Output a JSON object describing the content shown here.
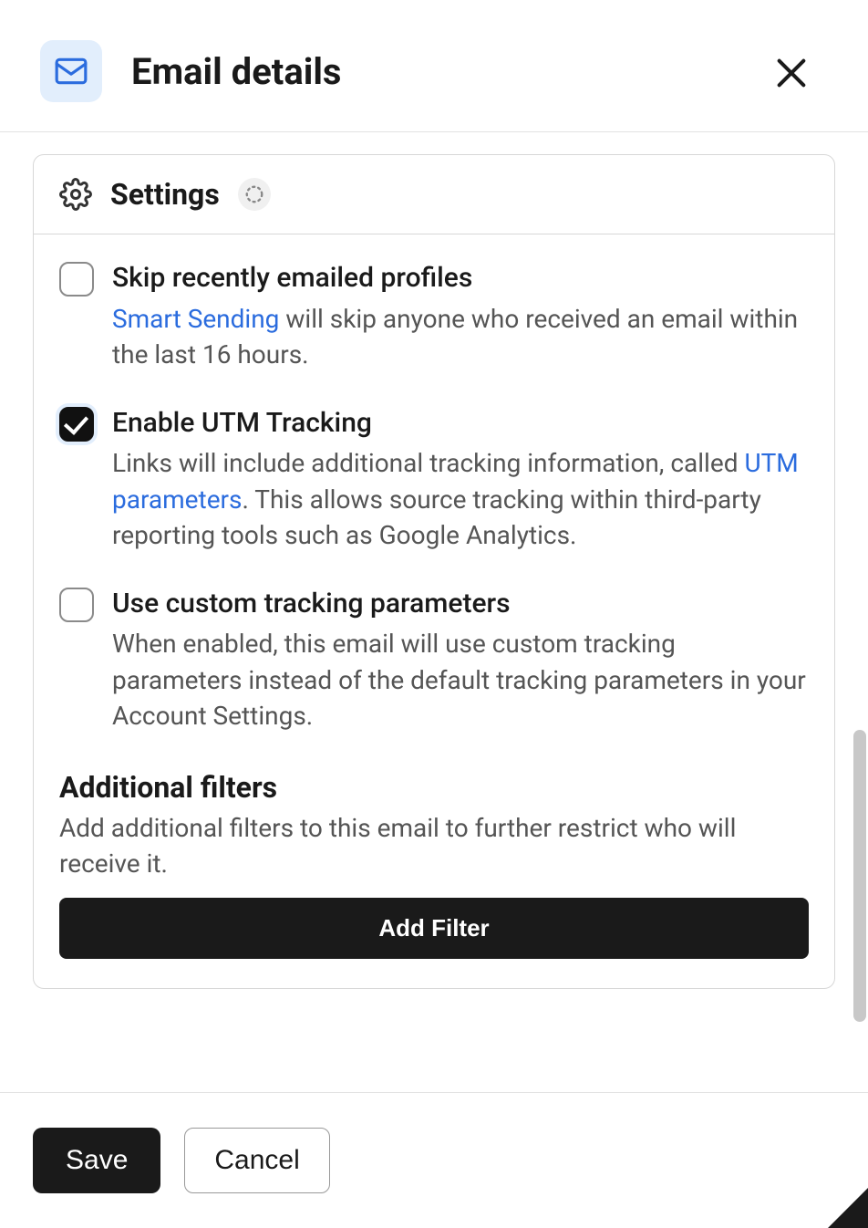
{
  "header": {
    "title": "Email details"
  },
  "panel": {
    "title": "Settings"
  },
  "settings": {
    "skip": {
      "label": "Skip recently emailed profiles",
      "link": "Smart Sending",
      "desc_rest": " will skip anyone who received an email within the last 16 hours.",
      "checked": false
    },
    "utm": {
      "label": "Enable UTM Tracking",
      "desc_before": "Links will include additional tracking information, called ",
      "link": "UTM parameters",
      "desc_after": ". This allows source tracking within third-party reporting tools such as Google Analytics.",
      "checked": true
    },
    "custom": {
      "label": "Use custom tracking parameters",
      "desc": "When enabled, this email will use custom tracking parameters instead of the default tracking parameters in your Account Settings.",
      "checked": false
    }
  },
  "filters": {
    "title": "Additional filters",
    "desc": "Add additional filters to this email to further restrict who will receive it.",
    "button": "Add Filter"
  },
  "footer": {
    "save": "Save",
    "cancel": "Cancel"
  }
}
